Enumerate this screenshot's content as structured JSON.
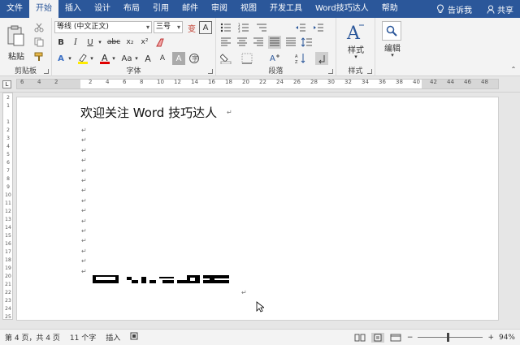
{
  "tabs": {
    "items": [
      {
        "label": "文件"
      },
      {
        "label": "开始"
      },
      {
        "label": "插入"
      },
      {
        "label": "设计"
      },
      {
        "label": "布局"
      },
      {
        "label": "引用"
      },
      {
        "label": "邮件"
      },
      {
        "label": "审阅"
      },
      {
        "label": "视图"
      },
      {
        "label": "开发工具"
      },
      {
        "label": "Word技巧达人"
      },
      {
        "label": "帮助"
      }
    ],
    "active": "开始",
    "tell_me": "告诉我",
    "share": "共享"
  },
  "ribbon": {
    "clipboard": {
      "paste_label": "粘贴",
      "group_label": "剪贴板"
    },
    "font": {
      "font_name": "等线 (中文正文)",
      "font_size": "三号",
      "bold": "B",
      "italic": "I",
      "underline": "U",
      "strike": "abc",
      "subscript": "x₂",
      "superscript": "x²",
      "grow": "A",
      "shrink": "A",
      "clear": "A",
      "aa": "Aa",
      "group_label": "字体"
    },
    "paragraph": {
      "group_label": "段落"
    },
    "styles": {
      "label": "样式",
      "group_label": "样式"
    },
    "editing": {
      "label": "编辑"
    }
  },
  "ruler": {
    "numbers": [
      "6",
      "4",
      "2",
      "",
      "2",
      "4",
      "6",
      "8",
      "10",
      "12",
      "14",
      "16",
      "18",
      "20",
      "22",
      "24",
      "26",
      "28",
      "30",
      "32",
      "34",
      "36",
      "38",
      "40",
      "42",
      "44",
      "46",
      "48"
    ],
    "vertical_numbers": [
      "2",
      "1",
      "",
      "1",
      "2",
      "3",
      "4",
      "5",
      "6",
      "7",
      "8",
      "9",
      "10",
      "11",
      "12",
      "13",
      "14",
      "15",
      "16",
      "17",
      "18",
      "19",
      "20",
      "21",
      "22",
      "23",
      "24",
      "25"
    ]
  },
  "document": {
    "title": "欢迎关注 Word 技巧达人",
    "paragraph_mark": "↵"
  },
  "status": {
    "page": "第 4 页，共 4 页",
    "words": "11 个字",
    "mode": "插入",
    "zoom_minus": "−",
    "zoom_plus": "+",
    "zoom": "94%",
    "zoom_value": 0.94
  }
}
